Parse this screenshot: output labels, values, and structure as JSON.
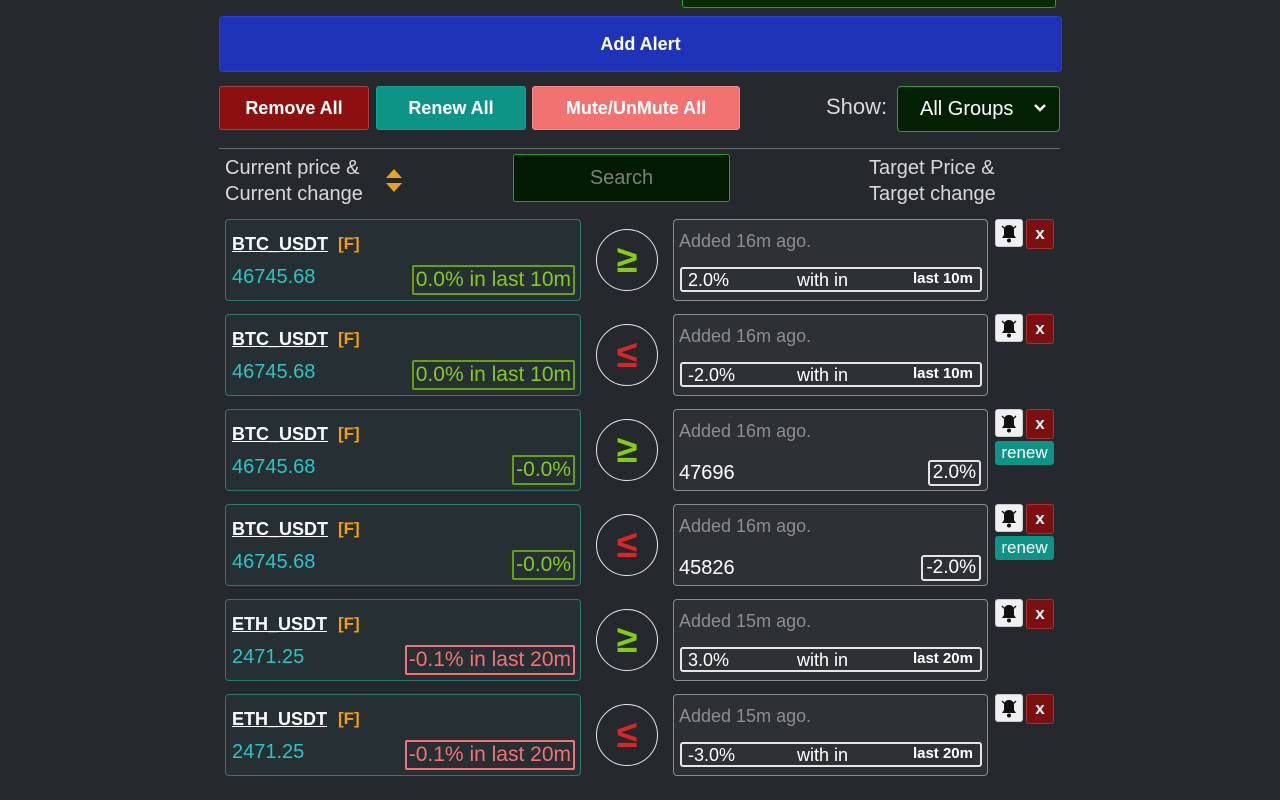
{
  "toolbar": {
    "add_alert": "Add Alert",
    "remove_all": "Remove All",
    "renew_all": "Renew All",
    "mute_all": "Mute/UnMute All",
    "show_label": "Show:",
    "group_value": "All Groups"
  },
  "header": {
    "current_line1": "Current price &",
    "current_line2": "Current change",
    "search_placeholder": "Search",
    "target_line1": "Target Price &",
    "target_line2": "Target change"
  },
  "colors": {
    "background": "#25292e",
    "add_alert": "#1f33b8",
    "remove": "#8d1010",
    "renew": "#0d9487",
    "mute": "#f27171",
    "price": "#2cc4c4",
    "positive": "#84cc16",
    "negative": "#f87171",
    "future_tag": "#f59e0b"
  },
  "icons": {
    "sort": "sort-up-down-icon",
    "bell": "bell-icon",
    "close": "close-icon",
    "chevron": "chevron-down-icon"
  },
  "alerts": [
    {
      "pair": "BTC_USDT",
      "tag": "[F]",
      "price": "46745.68",
      "change": "0.0% in last 10m",
      "change_sign": "pos",
      "op": "≥",
      "op_type": "ge",
      "added": "Added 16m ago.",
      "kind": "pct",
      "target_pct": "2.0%",
      "within": "with in",
      "last": "last 10m",
      "close": "x"
    },
    {
      "pair": "BTC_USDT",
      "tag": "[F]",
      "price": "46745.68",
      "change": "0.0% in last 10m",
      "change_sign": "pos",
      "op": "≤",
      "op_type": "le",
      "added": "Added 16m ago.",
      "kind": "pct",
      "target_pct": "-2.0%",
      "within": "with in",
      "last": "last 10m",
      "close": "x"
    },
    {
      "pair": "BTC_USDT",
      "tag": "[F]",
      "price": "46745.68",
      "change": "-0.0%",
      "change_sign": "pos",
      "op": "≥",
      "op_type": "ge",
      "added": "Added 16m ago.",
      "kind": "price",
      "target_price": "47696",
      "target_pct": "2.0%",
      "close": "x",
      "renew": "renew"
    },
    {
      "pair": "BTC_USDT",
      "tag": "[F]",
      "price": "46745.68",
      "change": "-0.0%",
      "change_sign": "pos",
      "op": "≤",
      "op_type": "le",
      "added": "Added 16m ago.",
      "kind": "price",
      "target_price": "45826",
      "target_pct": "-2.0%",
      "close": "x",
      "renew": "renew"
    },
    {
      "pair": "ETH_USDT",
      "tag": "[F]",
      "price": "2471.25",
      "change": "-0.1% in last 20m",
      "change_sign": "neg",
      "op": "≥",
      "op_type": "ge",
      "added": "Added 15m ago.",
      "kind": "pct",
      "target_pct": "3.0%",
      "within": "with in",
      "last": "last 20m",
      "close": "x"
    },
    {
      "pair": "ETH_USDT",
      "tag": "[F]",
      "price": "2471.25",
      "change": "-0.1% in last 20m",
      "change_sign": "neg",
      "op": "≤",
      "op_type": "le",
      "added": "Added 15m ago.",
      "kind": "pct",
      "target_pct": "-3.0%",
      "within": "with in",
      "last": "last 20m",
      "close": "x"
    }
  ]
}
